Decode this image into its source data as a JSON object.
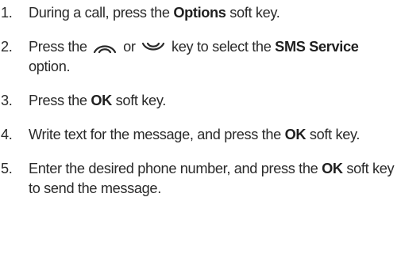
{
  "steps": [
    {
      "number": "1.",
      "text_before": "During a call, press the ",
      "bold": "Options",
      "text_after": " soft key."
    },
    {
      "number": "2.",
      "text_before": "Press the ",
      "icon_up": "up-navigation-key-icon",
      "text_middle": " or ",
      "icon_down": "down-navigation-key-icon",
      "text_after": " key to select the ",
      "bold": "SMS Service",
      "text_end": " option."
    },
    {
      "number": "3.",
      "text_before": "Press the ",
      "bold": "OK",
      "text_after": " soft key."
    },
    {
      "number": "4.",
      "text_before": "Write text for the message, and press the ",
      "bold": "OK",
      "text_after": " soft key."
    },
    {
      "number": "5.",
      "text_before": "Enter the desired phone number, and press the ",
      "bold": "OK",
      "text_after": " soft key to send the message."
    }
  ]
}
